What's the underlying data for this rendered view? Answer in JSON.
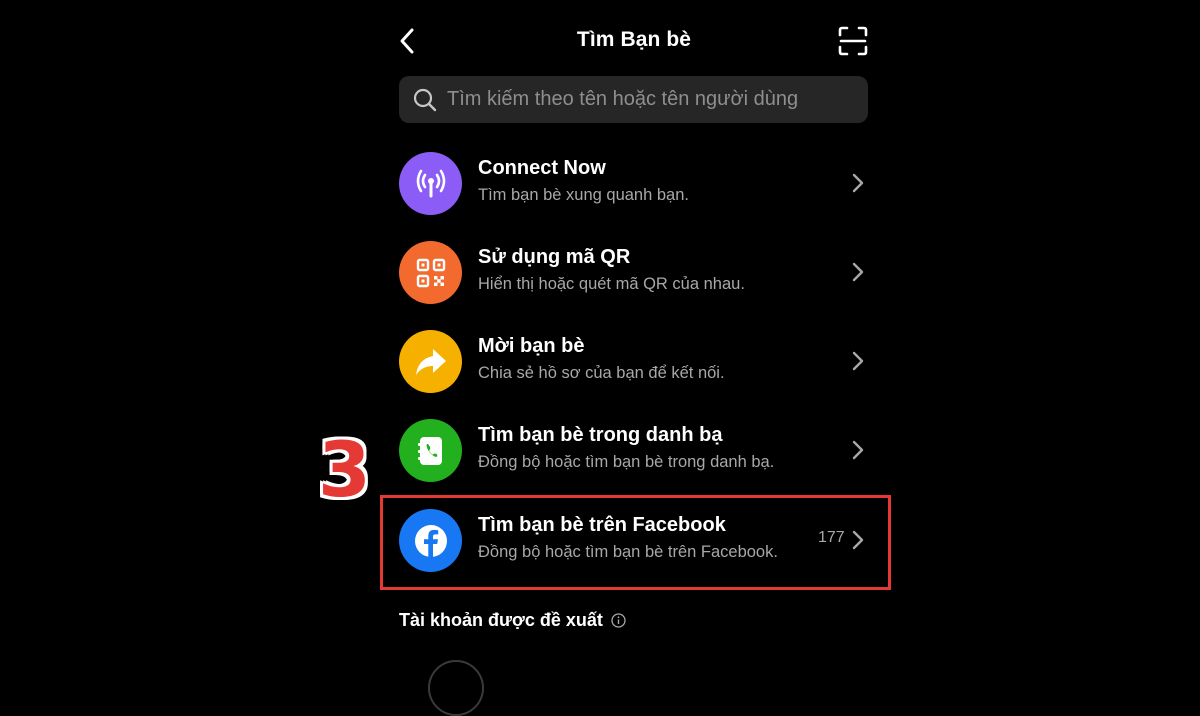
{
  "header": {
    "title": "Tìm Bạn bè"
  },
  "search": {
    "placeholder": "Tìm kiếm theo tên hoặc tên người dùng"
  },
  "options": [
    {
      "title": "Connect Now",
      "subtitle": "Tìm bạn bè xung quanh bạn.",
      "icon": "broadcast-icon",
      "color": "#8b5cf6"
    },
    {
      "title": "Sử dụng mã QR",
      "subtitle": "Hiển thị hoặc quét mã QR của nhau.",
      "icon": "qr-code-icon",
      "color": "#f26a2e"
    },
    {
      "title": "Mời bạn bè",
      "subtitle": "Chia sẻ hồ sơ của bạn để kết nối.",
      "icon": "share-arrow-icon",
      "color": "#f5b000"
    },
    {
      "title": "Tìm bạn bè trong danh bạ",
      "subtitle": "Đồng bộ hoặc tìm bạn bè trong danh bạ.",
      "icon": "phone-book-icon",
      "color": "#22b01e"
    },
    {
      "title": "Tìm bạn bè trên Facebook",
      "subtitle": "Đồng bộ hoặc tìm bạn bè trên Facebook.",
      "icon": "facebook-icon",
      "color": "#1877f2",
      "count": "177"
    }
  ],
  "suggested": {
    "label": "Tài khoản được đề xuất"
  },
  "annotation": {
    "step_number": "3",
    "color": "#e53935"
  }
}
